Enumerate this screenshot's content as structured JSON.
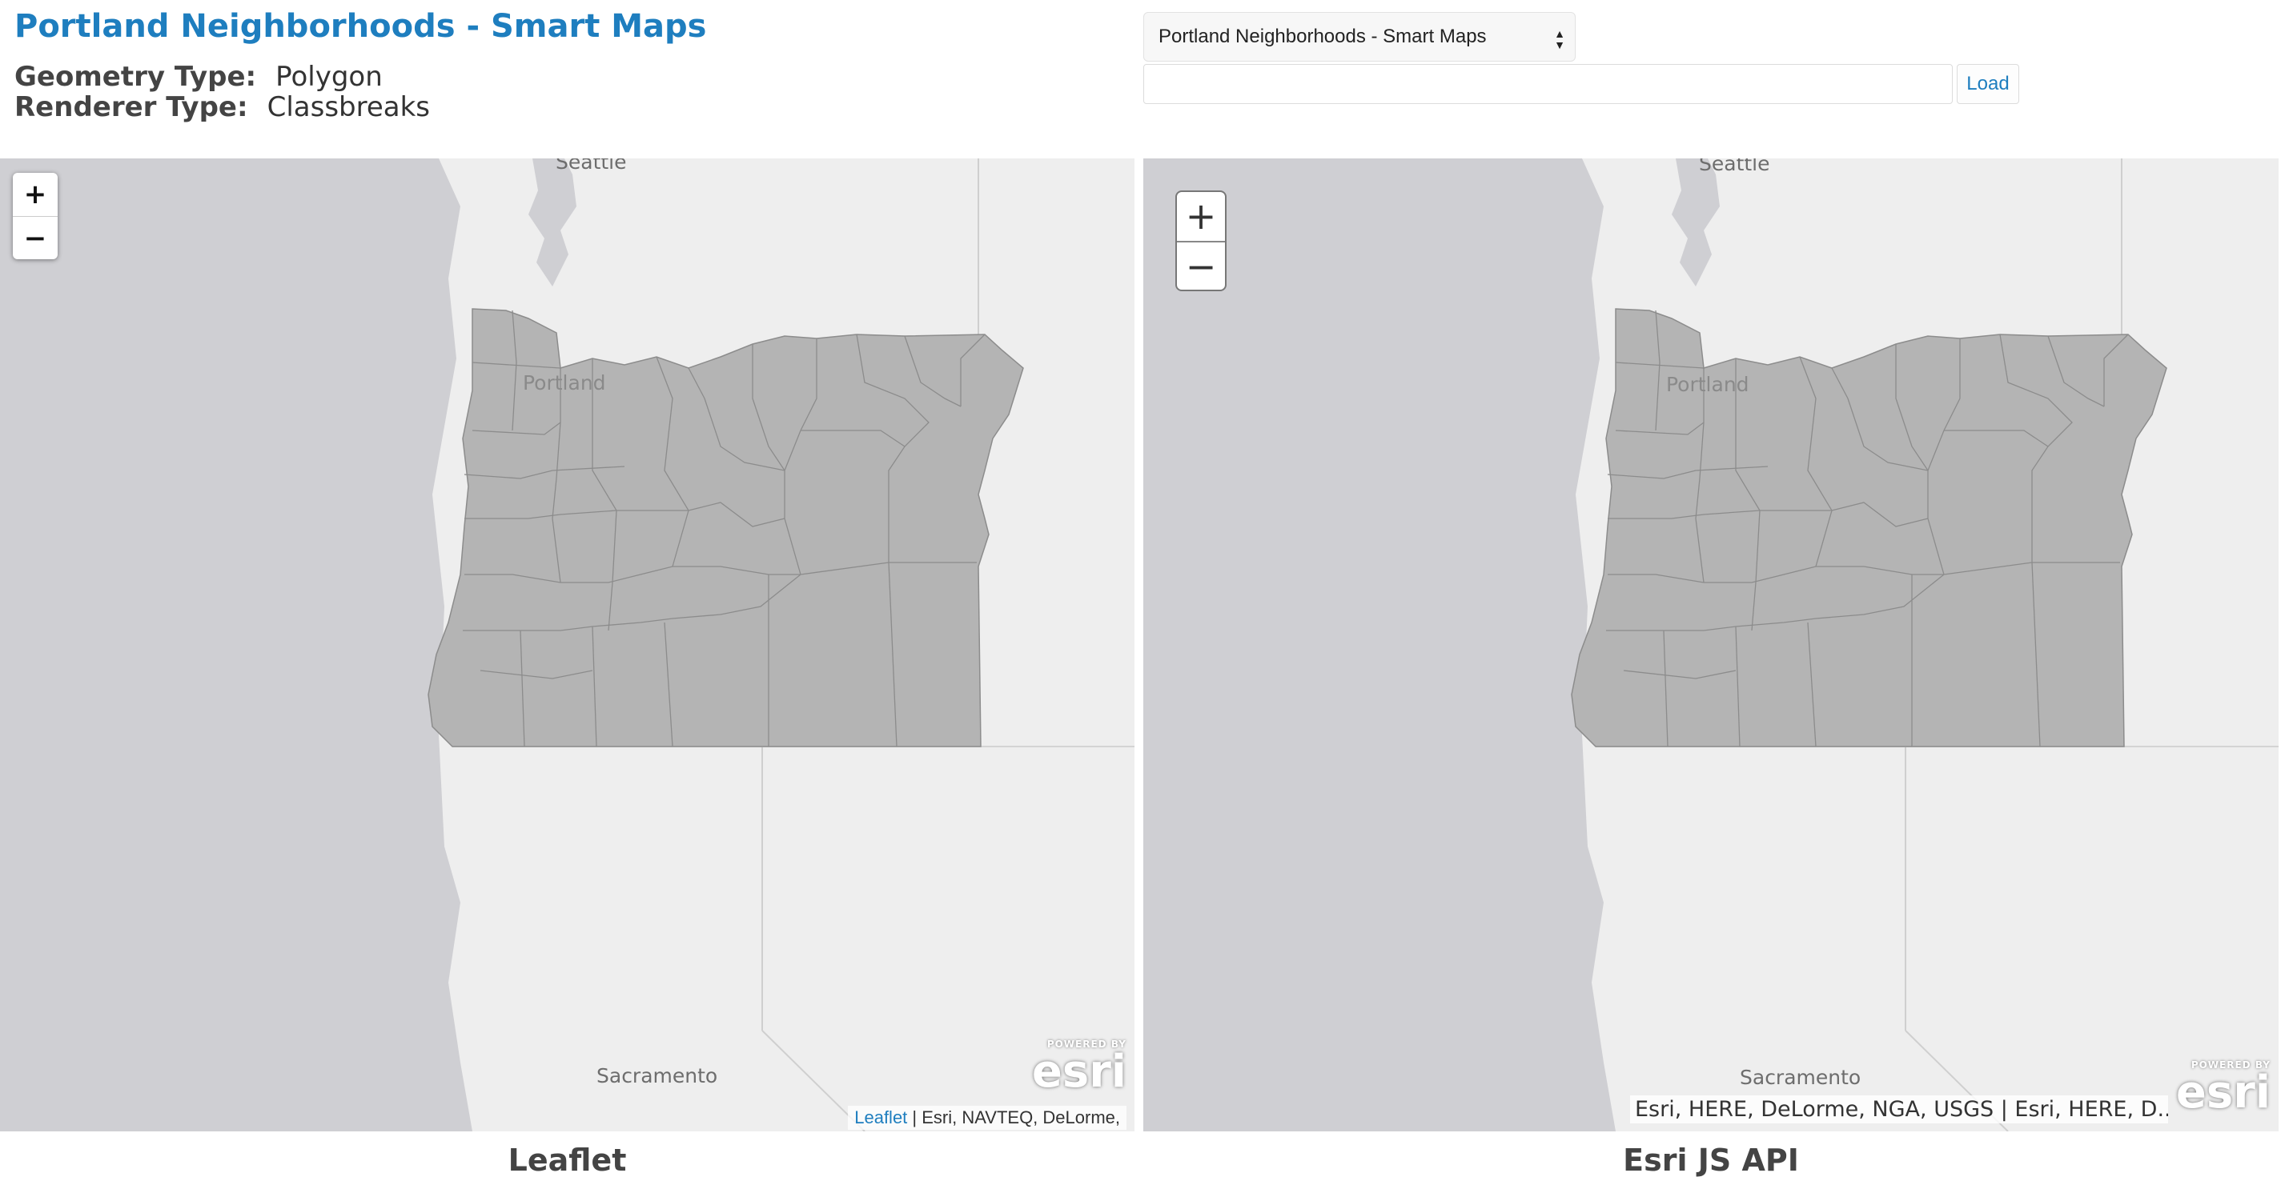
{
  "header": {
    "title": "Portland Neighborhoods - Smart Maps",
    "geometry_label": "Geometry Type:",
    "geometry_value": "Polygon",
    "renderer_label": "Renderer Type:",
    "renderer_value": "Classbreaks"
  },
  "controls": {
    "select_value": "Portland Neighborhoods - Smart Maps",
    "url_value": "",
    "load_label": "Load"
  },
  "maps": {
    "leaflet": {
      "zoom_in": "+",
      "zoom_out": "−",
      "cities": {
        "seattle": "Seattle",
        "portland": "Portland",
        "sacramento": "Sacramento"
      },
      "attribution_link": "Leaflet",
      "attribution_text": " | Esri, NAVTEQ, DeLorme,",
      "caption": "Leaflet"
    },
    "esri": {
      "zoom_in": "+",
      "zoom_out": "−",
      "cities": {
        "seattle": "Seattle",
        "portland": "Portland",
        "sacramento": "Sacramento"
      },
      "attribution_text": "Esri, HERE, DeLorme, NGA, USGS | Esri, HERE, D...",
      "caption": "Esri JS API"
    },
    "logo": {
      "powered_by": "POWERED BY",
      "name": "esri"
    }
  },
  "colors": {
    "title": "#1e7ebf",
    "ocean": "#cfcfd3",
    "land": "#eeeeee",
    "polygon_fill": "#b4b4b4",
    "polygon_stroke": "#8c8c8c"
  },
  "icons": [
    "zoom-in-icon",
    "zoom-out-icon",
    "select-arrows-icon",
    "esri-logo"
  ]
}
